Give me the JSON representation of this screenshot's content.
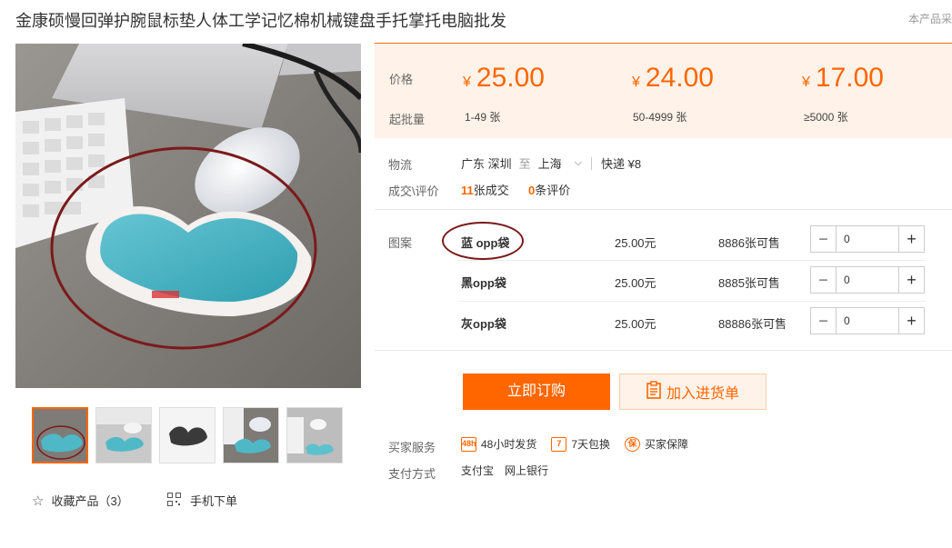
{
  "product": {
    "title": "金康硕慢回弹护腕鼠标垫人体工学记忆棉机械键盘手托掌托电脑批发",
    "report_text": "本产品采"
  },
  "price_panel": {
    "price_label": "价格",
    "moq_label": "起批量",
    "currency": "¥",
    "tiers": [
      {
        "price": "25.00",
        "qty": "1-49 张"
      },
      {
        "price": "24.00",
        "qty": "50-4999 张"
      },
      {
        "price": "17.00",
        "qty": "≥5000 张"
      }
    ]
  },
  "logistics": {
    "label": "物流",
    "from": "广东 深圳",
    "to_word": "至",
    "to": "上海",
    "express": "快递 ¥8"
  },
  "deals": {
    "label": "成交\\评价",
    "count": "11",
    "count_text": "张成交",
    "reviews": "0",
    "reviews_text": "条评价"
  },
  "pattern": {
    "label": "图案",
    "variants": [
      {
        "name": "蓝 opp袋",
        "price": "25.00元",
        "stock": "8886张可售",
        "qty": "0"
      },
      {
        "name": "黑opp袋",
        "price": "25.00元",
        "stock": "8885张可售",
        "qty": "0"
      },
      {
        "name": "灰opp袋",
        "price": "25.00元",
        "stock": "88886张可售",
        "qty": "0"
      }
    ]
  },
  "actions": {
    "buy": "立即订购",
    "cart": "加入进货单"
  },
  "services": {
    "label": "买家服务",
    "items": [
      {
        "icon": "48h",
        "text": "48小时发货"
      },
      {
        "icon": "7",
        "text": "7天包换"
      },
      {
        "icon": "保",
        "text": "买家保障"
      }
    ]
  },
  "payment": {
    "label": "支付方式",
    "methods": [
      "支付宝",
      "网上银行"
    ]
  },
  "bottom": {
    "favorite": "收藏产品（3）",
    "mobile_order": "手机下单"
  },
  "colors": {
    "accent": "#ff6600",
    "price_bg": "#fff2e8",
    "annotation": "#7b1a1a"
  }
}
